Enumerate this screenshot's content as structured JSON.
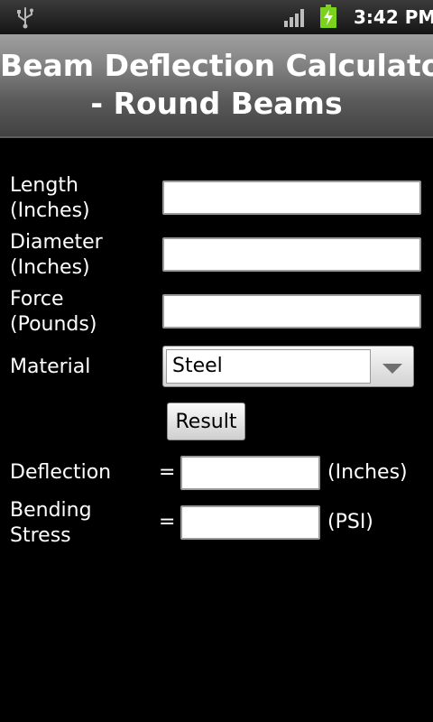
{
  "status_bar": {
    "time": "3:42 PM",
    "icons": [
      "usb-icon",
      "signal-icon",
      "battery-charging-icon"
    ],
    "battery_color": "#7bd21c"
  },
  "title": {
    "line1": "Beam Deflection Calculator",
    "line2": "- Round Beams"
  },
  "form": {
    "length": {
      "label_line1": "Length",
      "label_line2": "(Inches)",
      "value": ""
    },
    "diameter": {
      "label_line1": "Diameter",
      "label_line2": "(Inches)",
      "value": ""
    },
    "force": {
      "label_line1": "Force",
      "label_line2": "(Pounds)",
      "value": ""
    },
    "material": {
      "label": "Material",
      "selected": "Steel"
    }
  },
  "result_button": {
    "label": "Result"
  },
  "outputs": {
    "deflection": {
      "label": "Deflection",
      "equals": "=",
      "value": "",
      "unit": "(Inches)"
    },
    "bending_stress": {
      "label_line1": "Bending",
      "label_line2": "Stress",
      "equals": "=",
      "value": "",
      "unit": "(PSI)"
    }
  }
}
